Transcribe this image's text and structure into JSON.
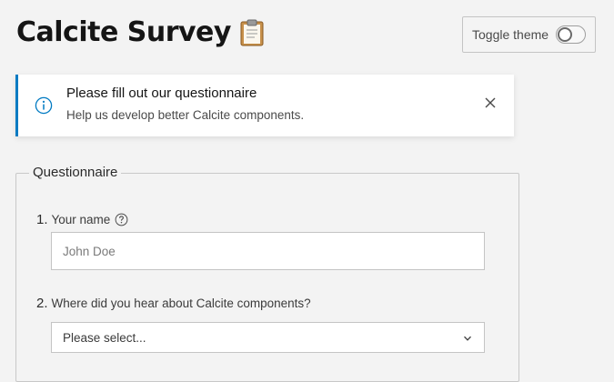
{
  "header": {
    "title": "Calcite Survey",
    "title_icon": "clipboard-icon"
  },
  "theme_toggle": {
    "label": "Toggle theme",
    "checked": false
  },
  "notice": {
    "icon": "info-icon",
    "title": "Please fill out our questionnaire",
    "message": "Help us develop better Calcite components.",
    "close_icon": "close-icon",
    "accent_color": "#007ac2"
  },
  "questionnaire": {
    "legend": "Questionnaire",
    "questions": [
      {
        "number": "1.",
        "label": "Your name",
        "help_icon": "question-circle-icon",
        "input_value": "",
        "placeholder": "John Doe"
      },
      {
        "number": "2.",
        "label": "Where did you hear about Calcite components?",
        "selected_value": "Please select...",
        "dropdown_icon": "chevron-down-icon"
      }
    ]
  }
}
